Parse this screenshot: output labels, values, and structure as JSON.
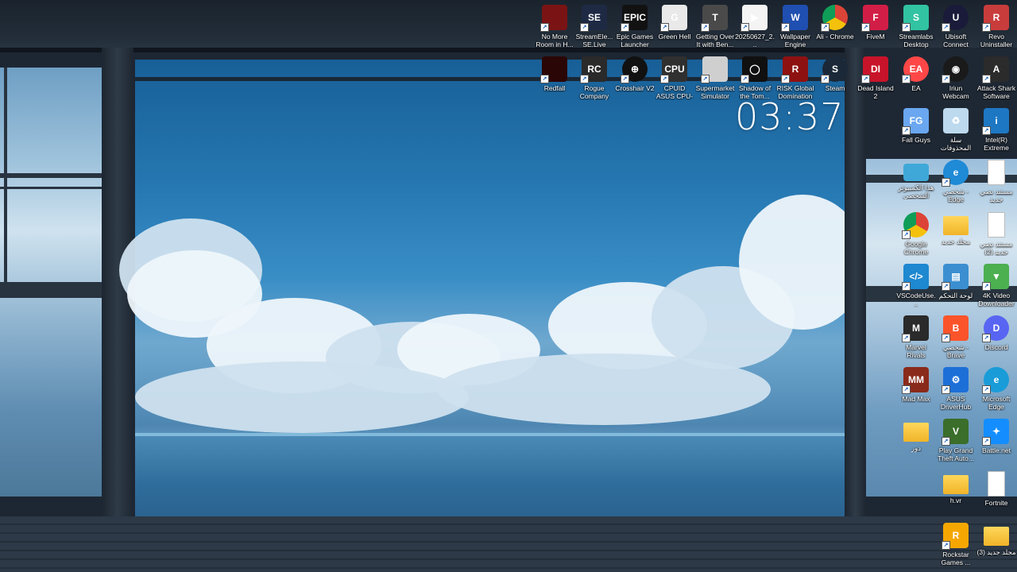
{
  "desktop": {
    "clock": "03:37",
    "icons": [
      {
        "label": "No More Room in H...",
        "icon": "no-more-room-icon",
        "color": "#7a1414",
        "text": ""
      },
      {
        "label": "StreamEle... SE.Live",
        "icon": "streamelements-icon",
        "color": "#1e2a44",
        "text": "SE"
      },
      {
        "label": "Epic Games Launcher",
        "icon": "epic-games-icon",
        "color": "#121212",
        "text": "EPIC"
      },
      {
        "label": "Green Hell",
        "icon": "green-hell-icon",
        "color": "#e9e9e9",
        "text": "G"
      },
      {
        "label": "Getting Over It with Ben...",
        "icon": "hammer-icon",
        "color": "#4a4a4a",
        "text": "T"
      },
      {
        "label": "20250627_2...",
        "icon": "video-file-icon",
        "color": "#f4f4f4",
        "text": "▶"
      },
      {
        "label": "Wallpaper Engine",
        "icon": "wallpaper-engine-icon",
        "color": "#1f4fb0",
        "text": "W"
      },
      {
        "label": "Ali - Chrome",
        "icon": "chrome-icon",
        "color": "#dd4b39",
        "text": ""
      },
      {
        "label": "FiveM",
        "icon": "fivem-icon",
        "color": "#d21e46",
        "text": "F"
      },
      {
        "label": "Streamlabs Desktop",
        "icon": "streamlabs-icon",
        "color": "#31c3a2",
        "text": "S"
      },
      {
        "label": "Ubisoft Connect",
        "icon": "ubisoft-icon",
        "color": "#1a1a3a",
        "text": "U"
      },
      {
        "label": "Revo Uninstaller",
        "icon": "revo-uninstaller-icon",
        "color": "#c93c3c",
        "text": "R"
      },
      {
        "label": "Redfall",
        "icon": "redfall-icon",
        "color": "#2a0606",
        "text": ""
      },
      {
        "label": "Rogue Company",
        "icon": "rogue-company-icon",
        "color": "#2a2a2a",
        "text": "RC"
      },
      {
        "label": "Crosshair V2",
        "icon": "crosshair-icon",
        "color": "#111111",
        "text": "⊕"
      },
      {
        "label": "CPUID ASUS CPU-Z",
        "icon": "cpu-z-icon",
        "color": "#303030",
        "text": "CPU"
      },
      {
        "label": "Supermarket Simulator",
        "icon": "supermarket-simulator-icon",
        "color": "#cfcfcf",
        "text": ""
      },
      {
        "label": "Shadow of the Tom...",
        "icon": "shadow-tomb-raider-icon",
        "color": "#101010",
        "text": "◯"
      },
      {
        "label": "RISK Global Domination",
        "icon": "risk-icon",
        "color": "#8e1111",
        "text": "R"
      },
      {
        "label": "Steam",
        "icon": "steam-icon",
        "color": "#1b2838",
        "text": "S"
      },
      {
        "label": "Dead Island 2",
        "icon": "dead-island-icon",
        "color": "#c8142a",
        "text": "DI"
      },
      {
        "label": "EA",
        "icon": "ea-icon",
        "color": "#ff4747",
        "text": "EA"
      },
      {
        "label": "Iriun Webcam",
        "icon": "iriun-webcam-icon",
        "color": "#1a1a1a",
        "text": "◉"
      },
      {
        "label": "Attack Shark Software",
        "icon": "attack-shark-icon",
        "color": "#2b2b2b",
        "text": "A"
      },
      {
        "label": "Fall Guys",
        "icon": "fall-guys-icon",
        "color": "#6aa7f0",
        "text": "FG"
      },
      {
        "label": "سلة المحذوفات",
        "icon": "recycle-bin-icon",
        "color": "#bcd9ee",
        "text": "♻"
      },
      {
        "label": "Intel(R) Extreme Tu...",
        "icon": "intel-xtu-icon",
        "color": "#1e77c3",
        "text": "i"
      },
      {
        "label": "هذا الكمبيوتر الشخصي",
        "icon": "this-pc-icon",
        "color": "#3fa8d8",
        "text": ""
      },
      {
        "label": "شخصي - Edge",
        "icon": "edge-icon",
        "color": "#1f8ad6",
        "text": "e"
      },
      {
        "label": "مستند نصي جديد",
        "icon": "text-document-icon",
        "color": "#ffffff",
        "text": ""
      },
      {
        "label": "Google Chrome",
        "icon": "google-chrome-icon",
        "color": "#dd4b39",
        "text": ""
      },
      {
        "label": "مجلد جديد",
        "icon": "folder-icon",
        "color": "#f0b429",
        "text": ""
      },
      {
        "label": "مستند نصي جديد (2)",
        "icon": "text-document-icon",
        "color": "#ffffff",
        "text": ""
      },
      {
        "label": "VSCodeUse...",
        "icon": "vscode-icon",
        "color": "#1e88d0",
        "text": "</>"
      },
      {
        "label": "لوحة التحكم",
        "icon": "control-panel-icon",
        "color": "#3b8fd0",
        "text": "▤"
      },
      {
        "label": "4K Video Downloader+",
        "icon": "4k-video-downloader-icon",
        "color": "#4caf50",
        "text": "▼"
      },
      {
        "label": "Marvel Rivals",
        "icon": "marvel-rivals-icon",
        "color": "#2a2a2a",
        "text": "M"
      },
      {
        "label": "شخصي - Brave",
        "icon": "brave-icon",
        "color": "#fb542b",
        "text": "B"
      },
      {
        "label": "Discord",
        "icon": "discord-icon",
        "color": "#5865f2",
        "text": "D"
      },
      {
        "label": "Mad Max",
        "icon": "mad-max-icon",
        "color": "#8a2a1a",
        "text": "MM"
      },
      {
        "label": "ASUS DriverHub",
        "icon": "asus-driverhub-icon",
        "color": "#1d6fd8",
        "text": "⚙"
      },
      {
        "label": "Microsoft Edge",
        "icon": "microsoft-edge-icon",
        "color": "#1a9cd8",
        "text": "e"
      },
      {
        "label": "دور",
        "icon": "folder-icon",
        "color": "#f0b429",
        "text": ""
      },
      {
        "label": "Play Grand Theft Auto...",
        "icon": "gta-v-icon",
        "color": "#3a6e2a",
        "text": "V"
      },
      {
        "label": "Battle.net",
        "icon": "battle-net-icon",
        "color": "#148eff",
        "text": "✦"
      },
      {
        "label": "h.vr",
        "icon": "folder-icon",
        "color": "#f0b429",
        "text": ""
      },
      {
        "label": "Fortnite",
        "icon": "text-document-icon",
        "color": "#ffffff",
        "text": ""
      },
      {
        "label": "Rockstar Games ...",
        "icon": "rockstar-icon",
        "color": "#f5a700",
        "text": "R"
      },
      {
        "label": "مجلد جديد (3)",
        "icon": "folder-icon",
        "color": "#f0b429",
        "text": ""
      }
    ]
  }
}
